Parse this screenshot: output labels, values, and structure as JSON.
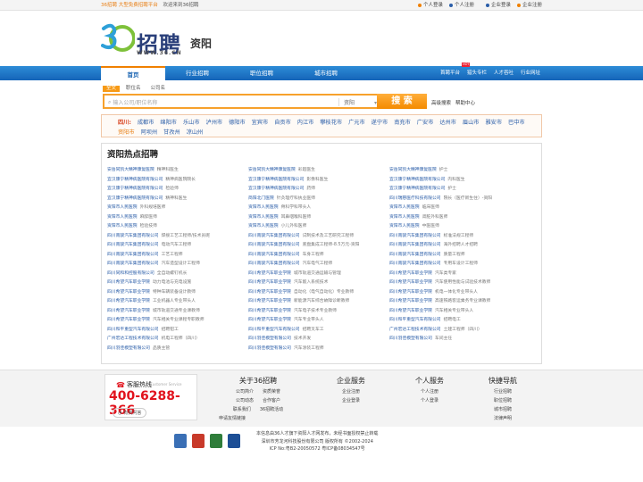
{
  "topbar": {
    "brand": "36招聘 大型免费招聘平台",
    "welcome": "欢迎来到36招聘",
    "person_login": "个人登录",
    "person_register": "个人注册",
    "company_login": "企业登录",
    "company_register": "企业注册"
  },
  "header": {
    "logo_title": "招聘",
    "logo_url": "WWW.36.CN",
    "city": "资阳"
  },
  "nav": {
    "main": [
      "首页",
      "行业招聘",
      "职位招聘",
      "城市招聘"
    ],
    "right": [
      "首聘平台",
      "猎头专栏",
      "人才吞吐",
      "行业网址"
    ],
    "hot_badge": "HOT"
  },
  "search": {
    "tabs": [
      "全文",
      "职位名",
      "公司名"
    ],
    "placeholder": "输入公司/职位名称",
    "city": "资阳",
    "button": "搜 索",
    "advanced": "高级搜索",
    "help": "帮助中心"
  },
  "cities": {
    "province": "四川:",
    "list": [
      "成都市",
      "绵阳市",
      "乐山市",
      "泸州市",
      "德阳市",
      "宜宾市",
      "自贡市",
      "内江市",
      "攀枝花市",
      "广元市",
      "遂宁市",
      "南充市",
      "广安市",
      "达州市",
      "眉山市",
      "雅安市",
      "巴中市",
      "资阳市",
      "阿坝州",
      "甘孜州",
      "凉山州"
    ],
    "current": "资阳市"
  },
  "hot": {
    "title": "资阳热点招聘",
    "items": [
      {
        "co": "安岳同凯大精神康复医院",
        "jb": "精神科医生"
      },
      {
        "co": "安岳同凯大精神康复医院",
        "jb": "彩超医生"
      },
      {
        "co": "安岳同凯大精神康复医院",
        "jb": "护士"
      },
      {
        "co": "宜汉康宁精神病医院有限公司",
        "jb": "精神病医院院长"
      },
      {
        "co": "宜汉康宁精神病医院有限公司",
        "jb": "影像科医生"
      },
      {
        "co": "宜汉康宁精神病医院有限公司",
        "jb": "内科医生"
      },
      {
        "co": "宜汉康宁精神病医院有限公司",
        "jb": "检验师"
      },
      {
        "co": "宜汉康宁精神病医院有限公司",
        "jb": "药师"
      },
      {
        "co": "宜汉康宁精神病医院有限公司",
        "jb": "护士"
      },
      {
        "co": "宜汉康宁精神病医院有限公司",
        "jb": "精神科医生"
      },
      {
        "co": "简阳北门医院",
        "jb": "针灸理疗科执业医师"
      },
      {
        "co": "四川瑞慈医疗科技有限公司",
        "jb": "院长（医疗新生住）-资阳"
      },
      {
        "co": "资阳市人民医院",
        "jb": "外科规培医师"
      },
      {
        "co": "资阳市人民医院",
        "jb": "骨科学科带头人"
      },
      {
        "co": "资阳市人民医院",
        "jb": "临床医师"
      },
      {
        "co": "资阳市人民医院",
        "jb": "麻醉医师"
      },
      {
        "co": "资阳市人民医院",
        "jb": "耳鼻咽喉科医师"
      },
      {
        "co": "资阳市人民医院",
        "jb": "肾脏外科医师"
      },
      {
        "co": "资阳市人民医院",
        "jb": "检验技师"
      },
      {
        "co": "资阳市人民医院",
        "jb": "小儿外科医师"
      },
      {
        "co": "资阳市人民医院",
        "jb": "中医医师"
      },
      {
        "co": "四川南骏汽车集团有限公司",
        "jb": "焊接工艺工程师/技术员呢"
      },
      {
        "co": "四川南骏汽车集团有限公司",
        "jb": "试制技术及工艺研究工程师"
      },
      {
        "co": "四川南骏汽车集团有限公司",
        "jb": "标准法规工程师"
      },
      {
        "co": "四川南骏汽车集团有限公司",
        "jb": "电动汽车工程师"
      },
      {
        "co": "四川南骏汽车集团有限公司",
        "jb": "底盘集成工程师-8.5万元-资阳"
      },
      {
        "co": "四川南骏汽车集团有限公司",
        "jb": "海外招聘人才招聘"
      },
      {
        "co": "四川南骏汽车集团有限公司",
        "jb": "工艺工程师"
      },
      {
        "co": "四川南骏汽车集团有限公司",
        "jb": "车身工程师"
      },
      {
        "co": "四川南骏汽车集团有限公司",
        "jb": "质量工程师"
      },
      {
        "co": "四川南骏汽车集团有限公司",
        "jb": "汽车造型设计工程师"
      },
      {
        "co": "四川南骏汽车集团有限公司",
        "jb": "汽车电气工程师"
      },
      {
        "co": "四川南骏汽车集团有限公司",
        "jb": "专用车设计工程师"
      },
      {
        "co": "四川同和和控股有限公司",
        "jb": "全自动螺钉机长"
      },
      {
        "co": "四川希望汽车职业学院",
        "jb": "城市轨道交通运输与管理"
      },
      {
        "co": "四川希望汽车职业学院",
        "jb": "汽车类专家"
      },
      {
        "co": "四川希望汽车职业学院",
        "jb": "动力电池与充电设施"
      },
      {
        "co": "四川希望汽车职业学院",
        "jb": "汽车嵌入系统技术"
      },
      {
        "co": "四川希望汽车职业学院",
        "jb": "汽车使用性能与试验技术教师"
      },
      {
        "co": "四川希望汽车职业学院",
        "jb": "特种车辆装备设计教师"
      },
      {
        "co": "四川希望汽车职业学院",
        "jb": "自动化（电气自动化）专业教师"
      },
      {
        "co": "四川希望汽车职业学院",
        "jb": "机电一体化专业带头人"
      },
      {
        "co": "四川希望汽车职业学院",
        "jb": "工业机器人专业带头人"
      },
      {
        "co": "四川希望汽车职业学院",
        "jb": "新能源汽车综合故障诊断教师"
      },
      {
        "co": "四川希望汽车职业学院",
        "jb": "高速铁路客运乘务专业课教师"
      },
      {
        "co": "四川希望汽车职业学院",
        "jb": "城市轨道交通专业课教师"
      },
      {
        "co": "四川希望汽车职业学院",
        "jb": "汽车电子技术专业教师"
      },
      {
        "co": "四川希望汽车职业学院",
        "jb": "汽车相关专业带头人"
      },
      {
        "co": "四川希望汽车职业学院",
        "jb": "汽车相关专业课程专职教师"
      },
      {
        "co": "四川希望汽车职业学院",
        "jb": "汽车专业带头人"
      },
      {
        "co": "四川和平重型汽车有限公司",
        "jb": "招聘电工"
      },
      {
        "co": "四川和平重型汽车有限公司",
        "jb": "招聘钳工"
      },
      {
        "co": "四川和平重型汽车有限公司",
        "jb": "招聘叉车工"
      },
      {
        "co": "广州宏达工程技术有限公司",
        "jb": "土建工程师（四川）"
      },
      {
        "co": "广州宏达工程技术有限公司",
        "jb": "机电工程师（四川）"
      },
      {
        "co": "四川羽佳模塑有限公司",
        "jb": "技术开发"
      },
      {
        "co": "四川羽佳模塑有限公司",
        "jb": "车间主任"
      },
      {
        "co": "四川羽佳模塑有限公司",
        "jb": "品质主管"
      },
      {
        "co": "四川羽佳模塑有限公司",
        "jb": "汽车涂装工程师"
      }
    ]
  },
  "footer": {
    "hotline_label": "客服热线",
    "hotline_en": "Customer Service",
    "hotline_number": "400-6288-366",
    "qa": "有奖问答",
    "about": {
      "title": "关于36招聘",
      "links": [
        "公司简介",
        "资质荣誉",
        "公司动态",
        "合作客户",
        "联系我们",
        "36招聘活动",
        "申请友情链接"
      ]
    },
    "company": {
      "title": "企业服务",
      "links": [
        "企业注册",
        "企业登录"
      ]
    },
    "person": {
      "title": "个人服务",
      "links": [
        "个人注册",
        "个人登录"
      ]
    },
    "quick": {
      "title": "快捷导航",
      "links": [
        "行业招聘",
        "职位招聘",
        "城市招聘",
        "法律声明"
      ]
    },
    "bottom_lines": [
      "本信息由36人才旗下资阳人才网发布，未经书面授权禁止转载",
      "深圳市芳龙河科技股份有限公司 版权所有 ©2002-2024",
      "ICP No:粤B2-20050572  粤ICP备08034547号"
    ]
  },
  "colors": {
    "nav_blue": "#1a6fc2",
    "accent_orange": "#f48b00",
    "hotline_red": "#e1131d",
    "link_blue": "#2a5da8"
  }
}
